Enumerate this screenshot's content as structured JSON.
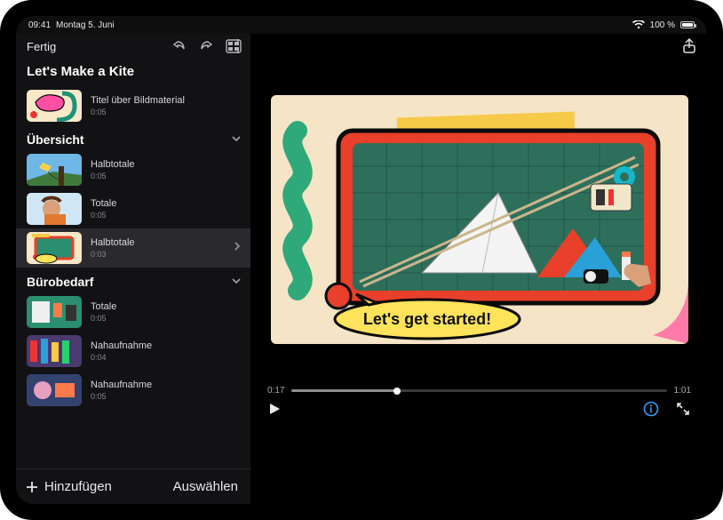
{
  "statusbar": {
    "time": "09:41",
    "date": "Montag 5. Juni",
    "battery_pct": "100 %"
  },
  "toolbar": {
    "done": "Fertig",
    "project_title": "Let's Make a Kite",
    "share_icon": "share-icon"
  },
  "sidebar": {
    "title_clip": {
      "label": "Titel über Bildmaterial",
      "duration": "0:05"
    },
    "sections": [
      {
        "name": "Übersicht",
        "clips": [
          {
            "label": "Halbtotale",
            "duration": "0:05"
          },
          {
            "label": "Totale",
            "duration": "0:05"
          },
          {
            "label": "Halbtotale",
            "duration": "0:03",
            "selected": true
          }
        ]
      },
      {
        "name": "Bürobedarf",
        "clips": [
          {
            "label": "Totale",
            "duration": "0:05"
          },
          {
            "label": "Nahaufnahme",
            "duration": "0:04"
          },
          {
            "label": "Nahaufnahme",
            "duration": "0:05"
          }
        ]
      }
    ],
    "bottom": {
      "add": "Hinzufügen",
      "select": "Auswählen"
    }
  },
  "preview": {
    "caption": "Let's get started!",
    "scrub": {
      "current": "0:17",
      "total": "1:01",
      "progress_pct": 28
    }
  }
}
